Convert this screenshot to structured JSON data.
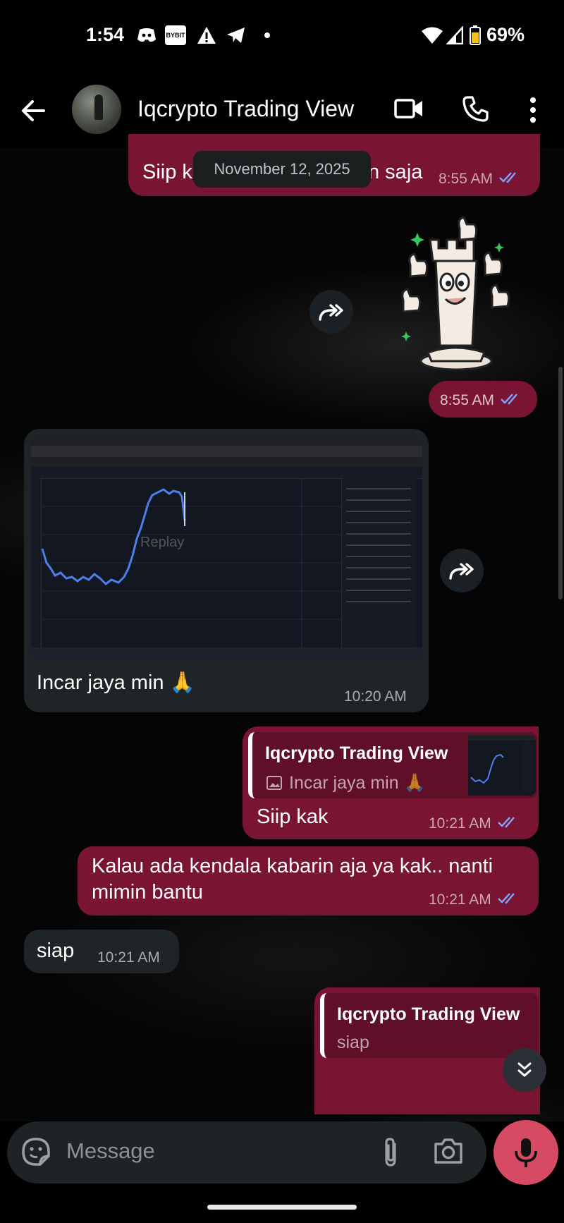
{
  "status_bar": {
    "time": "1:54",
    "bybit": "BYBIT",
    "battery": "69%"
  },
  "header": {
    "title": "Iqcrypto Trading View"
  },
  "date_chip": "November 12, 2025",
  "messages": [
    {
      "text_left": "Siip k",
      "text_right": "n saja",
      "time": "8:55 AM"
    },
    {
      "time": "8:55 AM"
    },
    {
      "text": "Incar jaya min 🙏",
      "time": "10:20 AM"
    },
    {
      "quote_name": "Iqcrypto Trading View",
      "quote_text": "Incar jaya min 🙏",
      "text": "Siip kak",
      "time": "10:21 AM"
    },
    {
      "text_line1": "Kalau ada kendala kabarin aja ya kak.. nanti",
      "text_line2": "mimin bantu",
      "time": "10:21 AM"
    },
    {
      "text": "siap",
      "time": "10:21 AM"
    },
    {
      "quote_name": "Iqcrypto Trading View",
      "quote_text": "siap"
    }
  ],
  "screenshot": {
    "replay_label": "Replay"
  },
  "composer": {
    "placeholder": "Message"
  },
  "colors": {
    "outgoing_bubble": "#7a1433",
    "incoming_bubble": "#1f2426",
    "mic_button": "#d64b63",
    "read_ticks": "#7da7ff"
  }
}
